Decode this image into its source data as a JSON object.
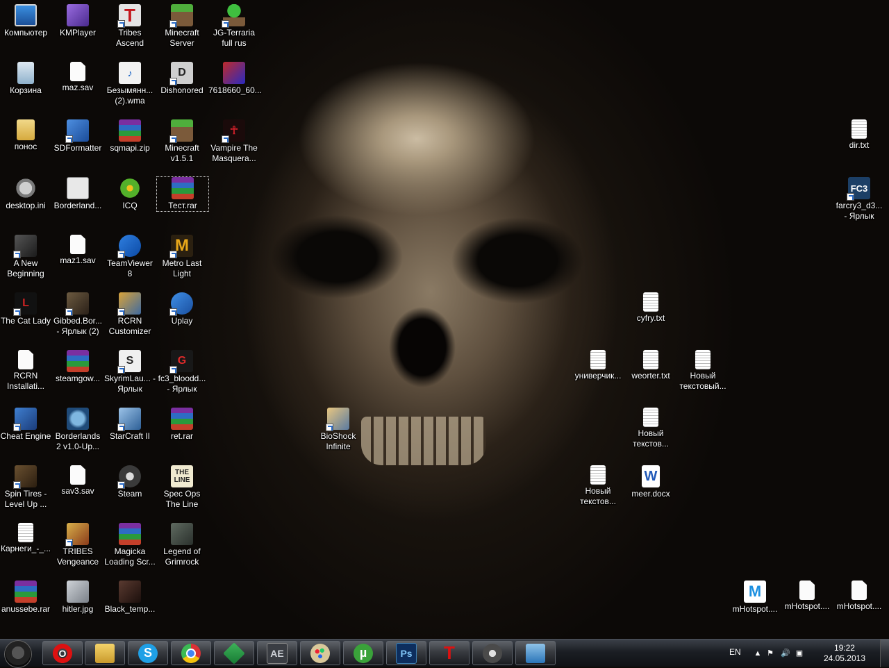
{
  "desktop_icons": {
    "computer": "Компьютер",
    "kmplayer": "KMPlayer",
    "tribes_ascend": "Tribes Ascend",
    "minecraft_server": "Minecraft Server",
    "jg_terraria": "JG-Terraria full rus",
    "recycle_bin": "Корзина",
    "maz_sav": "maz.sav",
    "bezymyannyi_wma": "Безымянн... (2).wma",
    "dishonored": "Dishonored",
    "image_7618660": "7618660_60...",
    "ponos": "понос",
    "sdformatter": "SDFormatter",
    "sqmapi_zip": "sqmapi.zip",
    "minecraft_151": "Minecraft v1.5.1",
    "vampire": "Vampire The Masquera...",
    "desktop_ini": "desktop.ini",
    "borderland": "Borderland...",
    "icq": "ICQ",
    "test_rar": "Тест.rar",
    "a_new_beginning": "A New Beginning",
    "maz1_sav": "maz1.sav",
    "teamviewer": "TeamViewer 8",
    "metro_last_light": "Metro Last Light",
    "cat_lady": "The Cat Lady",
    "gibbed": "Gibbed.Bor... - Ярлык (2)",
    "rcrn_customizer": "RCRN Customizer",
    "uplay": "Uplay",
    "rcrn_install": "RCRN Installati...",
    "steamgow": "steamgow...",
    "skyrim": "SkyrimLau... - Ярлык",
    "fc3_blood": "fc3_bloodd... - Ярлык",
    "cheat_engine": "Cheat Engine",
    "borderlands2": "Borderlands 2 v1.0-Up...",
    "starcraft2": "StarCraft II",
    "ret_rar": "ret.rar",
    "spin_tires": "Spin Tires - Level Up ...",
    "sav3_sav": "sav3.sav",
    "steam": "Steam",
    "spec_ops": "Spec Ops The Line",
    "karnegi": "Карнеги_-_...",
    "tribes_vengeance": "TRIBES Vengeance",
    "magicka": "Magicka Loading Scr...",
    "legend_grimrock": "Legend of Grimrock",
    "anussebe_rar": "anussebe.rar",
    "hitler_jpg": "hitler.jpg",
    "black_temp": "Black_temp...",
    "bioshock": "BioShock Infinite",
    "cyfry_txt": "cyfry.txt",
    "universitet": "универчик...",
    "weorter_txt": "weorter.txt",
    "novyi_txt1": "Новый текстовый...",
    "novyi_txt2": "Новый текстов...",
    "novyi_txt3": "Новый текстов...",
    "meer_docx": "meer.docx",
    "dir_txt": "dir.txt",
    "farcry3": "farcry3_d3... - Ярлык",
    "mhotspot1": "mHotspot....",
    "mhotspot2": "mHotspot....",
    "mhotspot3": "mHotspot...."
  },
  "glyphs": {
    "tribes": "T",
    "metro": "M",
    "vampire": "☥",
    "dishonored": "D",
    "skyrim": "S",
    "spec_ops": "THE LINE",
    "farcry3": "FC3",
    "docx": "W",
    "mhotspot": "M",
    "wma": "♪",
    "fc3_blood": "G",
    "cat_lady": "L"
  },
  "taskbar": {
    "opera": "O",
    "skype": "S",
    "ae": "AE",
    "utorrent": "µ",
    "ps": "Ps",
    "tribes": "T",
    "lang": "EN",
    "tray_arrow": "▲",
    "tray_volume": "🔊",
    "tray_flag": "⚑",
    "tray_network": "▣",
    "time": "19:22",
    "date": "24.05.2013"
  }
}
